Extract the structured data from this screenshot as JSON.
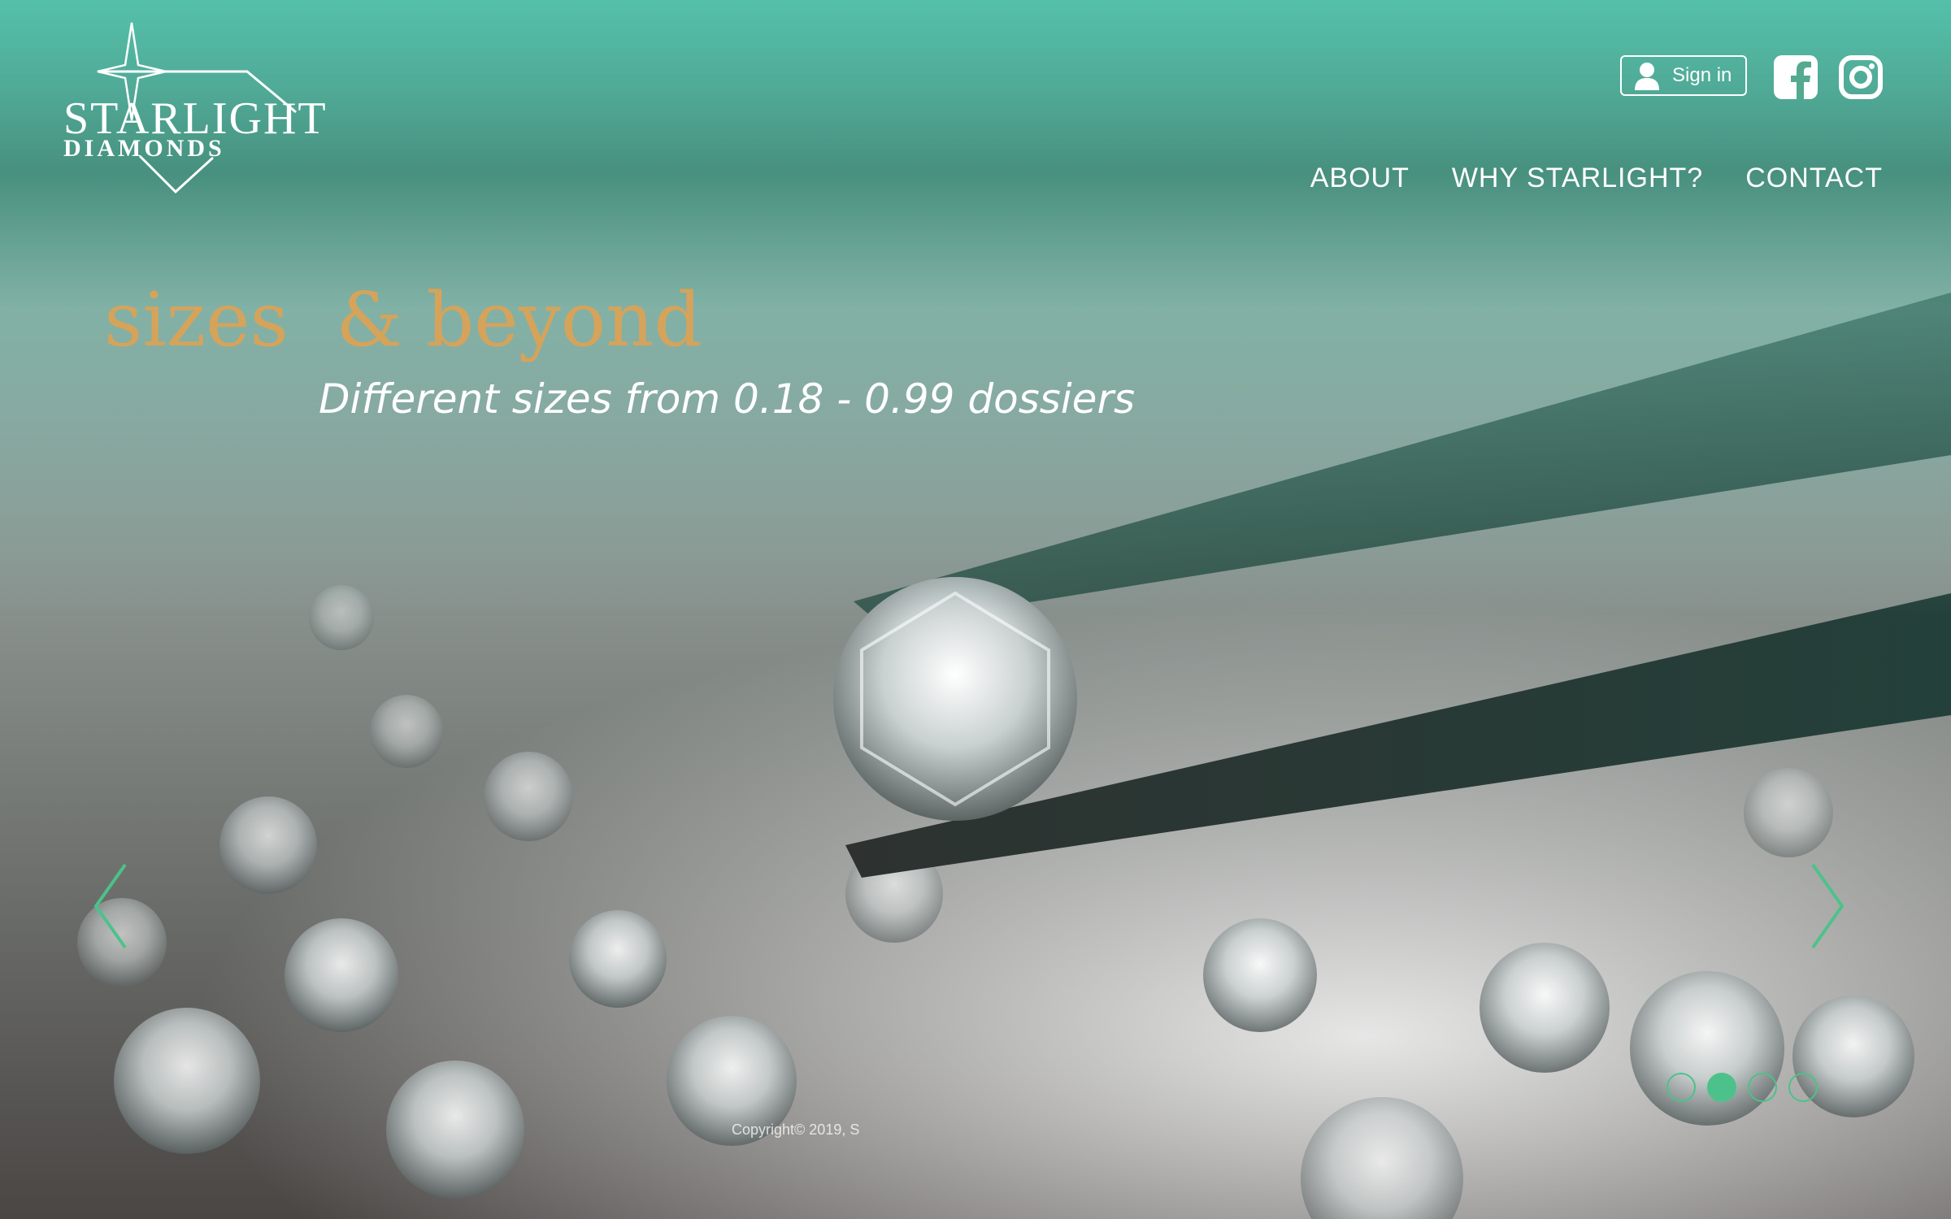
{
  "brand": {
    "name": "STARLIGHT",
    "tagline": "DIAMONDS"
  },
  "header": {
    "signin_label": "Sign in",
    "social": [
      {
        "name": "facebook",
        "icon": "facebook-icon"
      },
      {
        "name": "instagram",
        "icon": "instagram-icon"
      }
    ],
    "nav": [
      {
        "label": "ABOUT"
      },
      {
        "label": "WHY STARLIGHT?"
      },
      {
        "label": "CONTACT"
      }
    ]
  },
  "hero": {
    "headline": "sizes  & beyond",
    "subline": "Different sizes from 0.18 - 0.99 dossiers"
  },
  "carousel": {
    "slide_count": 4,
    "active_index": 1
  },
  "footer": {
    "copyright": "Copyright© 2019, S"
  },
  "colors": {
    "teal": "#54c0aa",
    "gold": "#d6a35a",
    "accent_green": "#4cc28a",
    "white": "#ffffff"
  }
}
